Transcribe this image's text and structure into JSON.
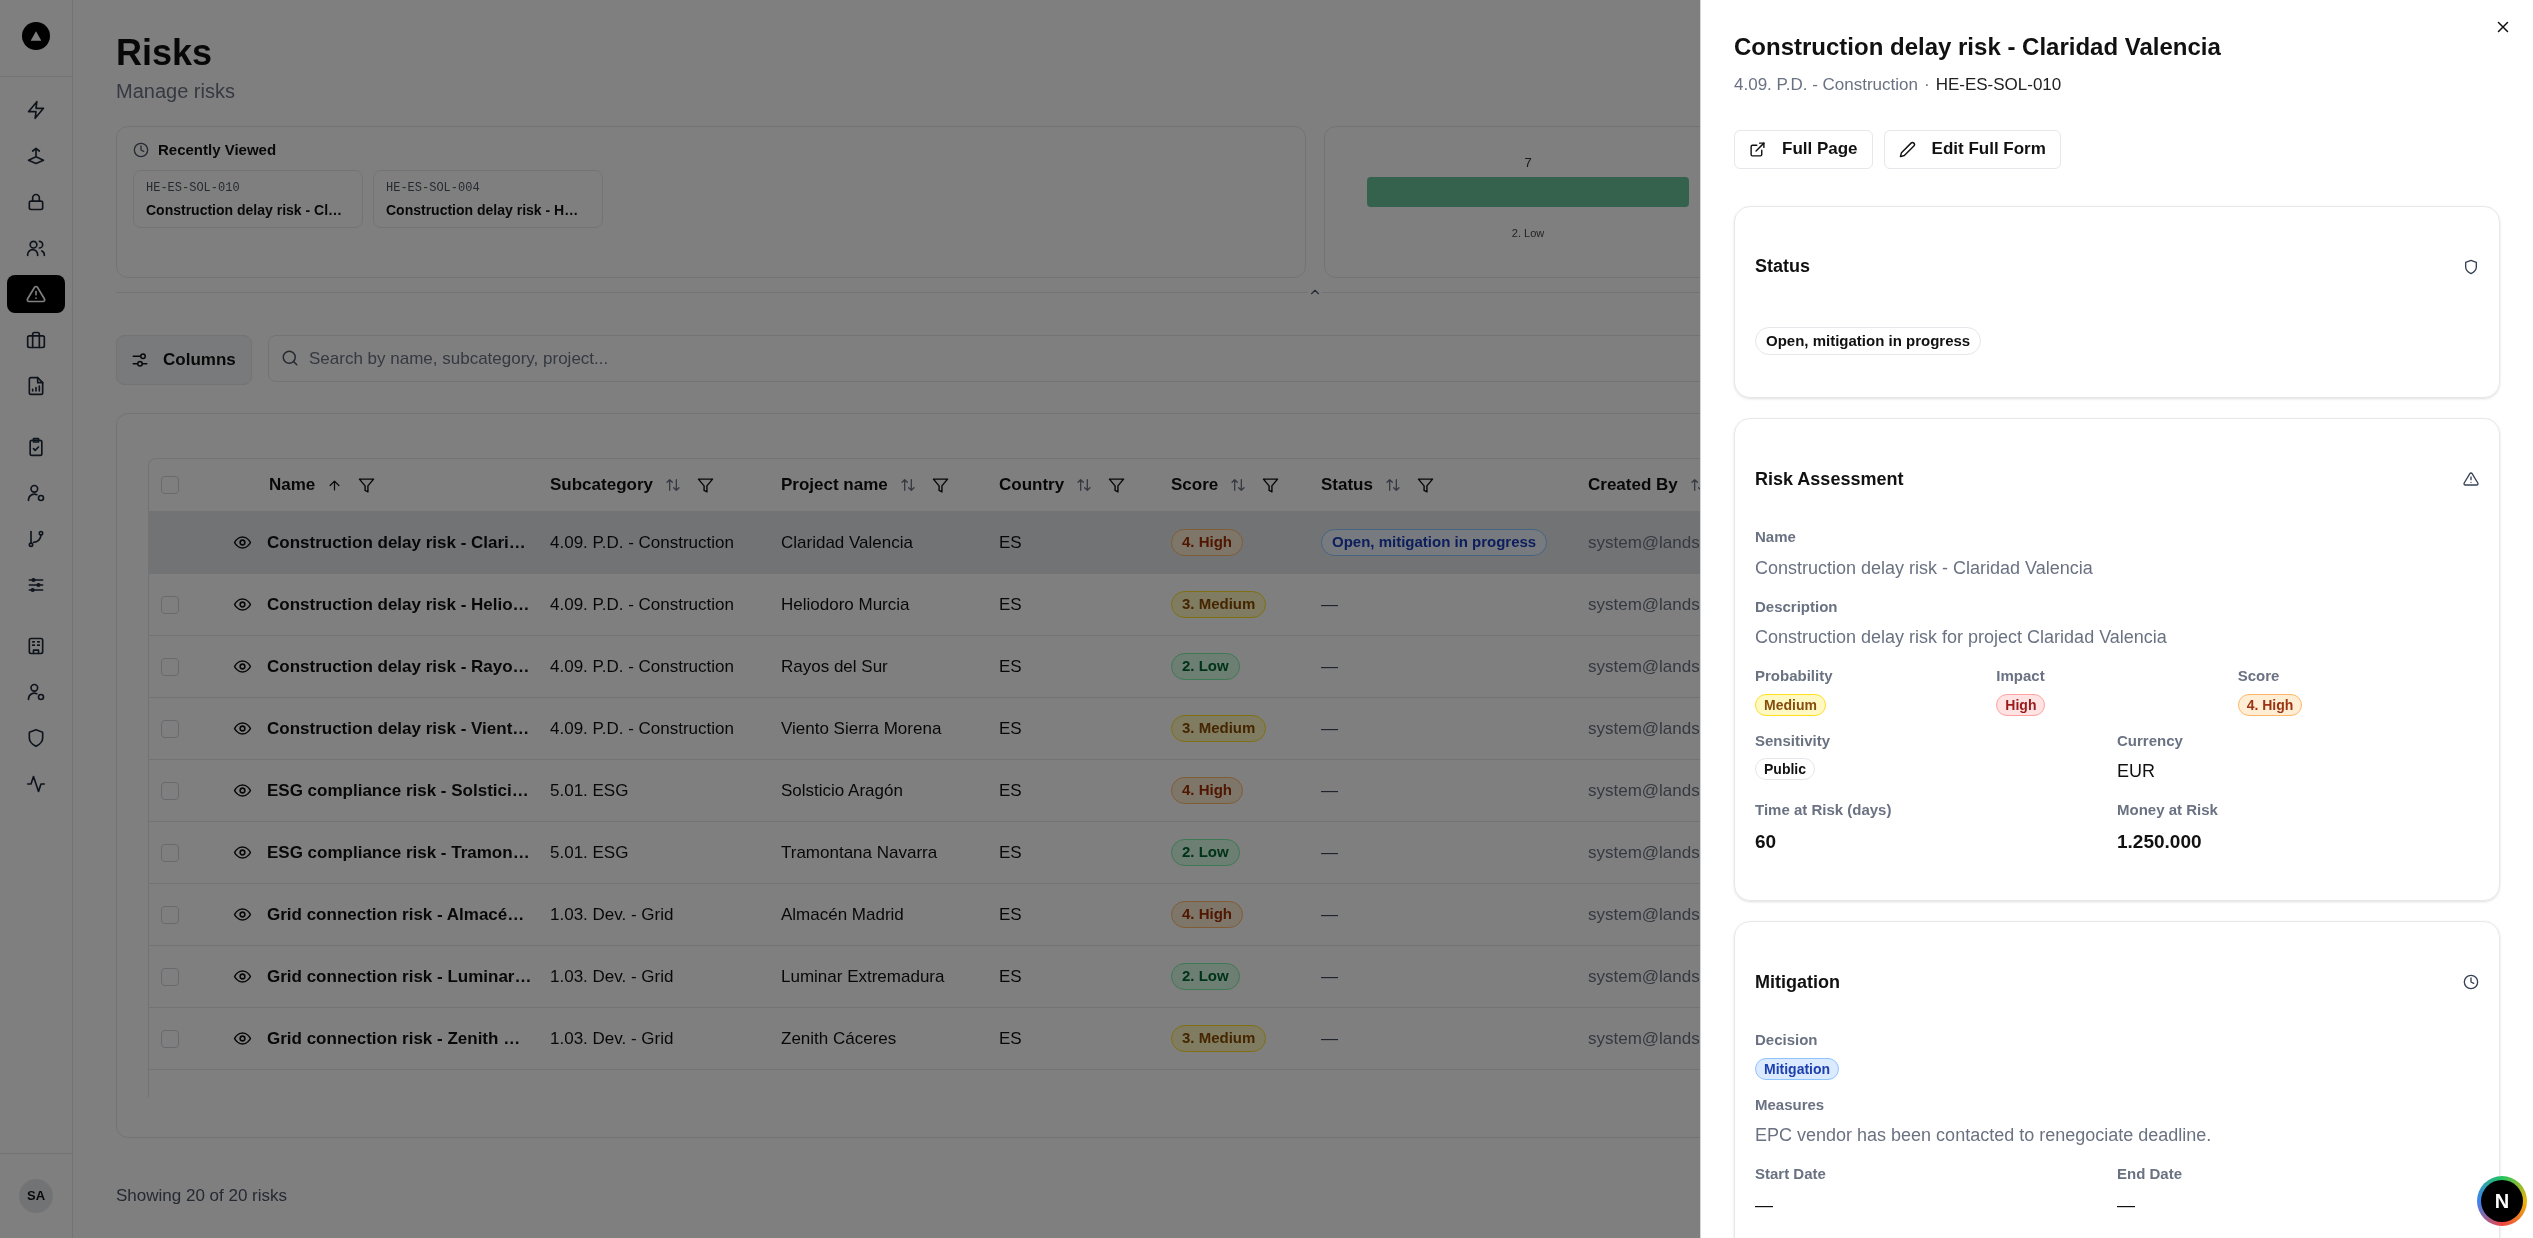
{
  "sidebar": {
    "groups": [
      [
        {
          "selected": false
        },
        {
          "selected": false
        },
        {
          "selected": false
        },
        {
          "selected": false
        },
        {
          "selected": true
        },
        {
          "selected": false
        },
        {
          "selected": false
        }
      ],
      [
        {
          "selected": false
        },
        {
          "selected": false
        },
        {
          "selected": false
        },
        {
          "selected": false
        }
      ],
      [
        {
          "selected": false
        },
        {
          "selected": false
        },
        {
          "selected": false
        },
        {
          "selected": false
        }
      ]
    ],
    "avatar": "SA"
  },
  "header": {
    "title": "Risks",
    "subtitle": "Manage risks"
  },
  "recently_viewed": {
    "title": "Recently Viewed",
    "items": [
      {
        "code": "HE-ES-SOL-010",
        "name": "Construction delay risk - Cl…"
      },
      {
        "code": "HE-ES-SOL-004",
        "name": "Construction delay risk - H…"
      }
    ]
  },
  "score_chart": {
    "bars": [
      {
        "value_label": "7",
        "category": "2. Low"
      }
    ]
  },
  "toolbar": {
    "columns_button": "Columns",
    "search": {
      "placeholder": "Search by name, subcategory, project..."
    }
  },
  "table": {
    "select_all_checked": false,
    "columns": [
      {
        "label": "Name",
        "sorted": true,
        "filter": true
      },
      {
        "label": "Subcategory",
        "sorted": false,
        "filter": true
      },
      {
        "label": "Project name",
        "sorted": false,
        "filter": true
      },
      {
        "label": "Country",
        "sorted": false,
        "filter": true
      },
      {
        "label": "Score",
        "sorted": false,
        "filter": true
      },
      {
        "label": "Status",
        "sorted": false,
        "filter": true
      },
      {
        "label": "Created By",
        "sorted": false,
        "filter": false
      }
    ],
    "rows": [
      {
        "selected": true,
        "name": "Construction delay risk - Clari…",
        "subcategory": "4.09. P.D. - Construction",
        "project": "Claridad Valencia",
        "country": "ES",
        "score": {
          "label": "4. High",
          "kind": "high"
        },
        "status": {
          "label": "Open, mitigation in progress",
          "kind": "open"
        },
        "created_by": "system@lands"
      },
      {
        "selected": false,
        "name": "Construction delay risk - Helio…",
        "subcategory": "4.09. P.D. - Construction",
        "project": "Heliodoro Murcia",
        "country": "ES",
        "score": {
          "label": "3. Medium",
          "kind": "medium"
        },
        "status": {
          "label": "—"
        },
        "created_by": "system@lands"
      },
      {
        "selected": false,
        "name": "Construction delay risk - Rayo…",
        "subcategory": "4.09. P.D. - Construction",
        "project": "Rayos del Sur",
        "country": "ES",
        "score": {
          "label": "2. Low",
          "kind": "low"
        },
        "status": {
          "label": "—"
        },
        "created_by": "system@lands"
      },
      {
        "selected": false,
        "name": "Construction delay risk - Vient…",
        "subcategory": "4.09. P.D. - Construction",
        "project": "Viento Sierra Morena",
        "country": "ES",
        "score": {
          "label": "3. Medium",
          "kind": "medium"
        },
        "status": {
          "label": "—"
        },
        "created_by": "system@lands"
      },
      {
        "selected": false,
        "name": "ESG compliance risk - Solstici…",
        "subcategory": "5.01. ESG",
        "project": "Solsticio Aragón",
        "country": "ES",
        "score": {
          "label": "4. High",
          "kind": "high"
        },
        "status": {
          "label": "—"
        },
        "created_by": "system@lands"
      },
      {
        "selected": false,
        "name": "ESG compliance risk - Tramon…",
        "subcategory": "5.01. ESG",
        "project": "Tramontana Navarra",
        "country": "ES",
        "score": {
          "label": "2. Low",
          "kind": "low"
        },
        "status": {
          "label": "—"
        },
        "created_by": "system@lands"
      },
      {
        "selected": false,
        "name": "Grid connection risk - Almacé…",
        "subcategory": "1.03. Dev. - Grid",
        "project": "Almacén Madrid",
        "country": "ES",
        "score": {
          "label": "4. High",
          "kind": "high"
        },
        "status": {
          "label": "—"
        },
        "created_by": "system@lands"
      },
      {
        "selected": false,
        "name": "Grid connection risk - Luminar…",
        "subcategory": "1.03. Dev. - Grid",
        "project": "Luminar Extremadura",
        "country": "ES",
        "score": {
          "label": "2. Low",
          "kind": "low"
        },
        "status": {
          "label": "—"
        },
        "created_by": "system@lands"
      },
      {
        "selected": false,
        "name": "Grid connection risk - Zenith …",
        "subcategory": "1.03. Dev. - Grid",
        "project": "Zenith Cáceres",
        "country": "ES",
        "score": {
          "label": "3. Medium",
          "kind": "medium"
        },
        "status": {
          "label": "—"
        },
        "created_by": "system@lands"
      }
    ]
  },
  "footer": "Showing 20 of 20 risks",
  "drawer": {
    "title": "Construction delay risk - Claridad Valencia",
    "subcategory": "4.09. P.D. - Construction",
    "separator": "·",
    "code": "HE-ES-SOL-010",
    "buttons": [
      {
        "label": "Full Page",
        "kind": "open"
      },
      {
        "label": "Edit Full Form",
        "kind": "edit"
      }
    ],
    "sections": [
      {
        "title": "Status",
        "kind": "status",
        "rows": [
          [
            {
              "value": "Open, mitigation in progress",
              "kind": "pill",
              "color": "#111111"
            }
          ]
        ]
      },
      {
        "title": "Risk Assessment",
        "kind": "assessment",
        "rows": [
          [
            {
              "label": "Name",
              "value": "Construction delay risk - Claridad Valencia",
              "kind": "text"
            }
          ],
          [
            {
              "label": "Description",
              "value": "Construction delay risk for project Claridad Valencia",
              "kind": "text"
            }
          ],
          [
            {
              "label": "Probability",
              "value": "Medium",
              "kind": "badge",
              "color": "#854d0e"
            },
            {
              "label": "Impact",
              "value": "High",
              "kind": "badge",
              "color": "#991b1b"
            },
            {
              "label": "Score",
              "value": "4. High",
              "kind": "badge",
              "color": "#9a3412"
            }
          ],
          [
            {
              "label": "Sensitivity",
              "value": "Public",
              "kind": "badge",
              "color": "#111111"
            },
            {
              "label": "Currency",
              "value": "EUR",
              "kind": "plain"
            }
          ],
          [
            {
              "label": "Time at Risk (days)",
              "value": "60",
              "kind": "strong"
            },
            {
              "label": "Money at Risk",
              "value": "1.250.000",
              "kind": "strong"
            }
          ]
        ]
      },
      {
        "title": "Mitigation",
        "kind": "mitigation",
        "rows": [
          [
            {
              "label": "Decision",
              "value": "Mitigation",
              "kind": "badge",
              "color": "#1e40af"
            }
          ],
          [
            {
              "label": "Measures",
              "value": "EPC vendor has been contacted to renegociate deadline.",
              "kind": "text"
            }
          ],
          [
            {
              "label": "Start Date",
              "value": "—",
              "kind": "plain"
            },
            {
              "label": "End Date",
              "value": "—",
              "kind": "plain"
            }
          ]
        ]
      }
    ]
  },
  "dev_badge": "N"
}
